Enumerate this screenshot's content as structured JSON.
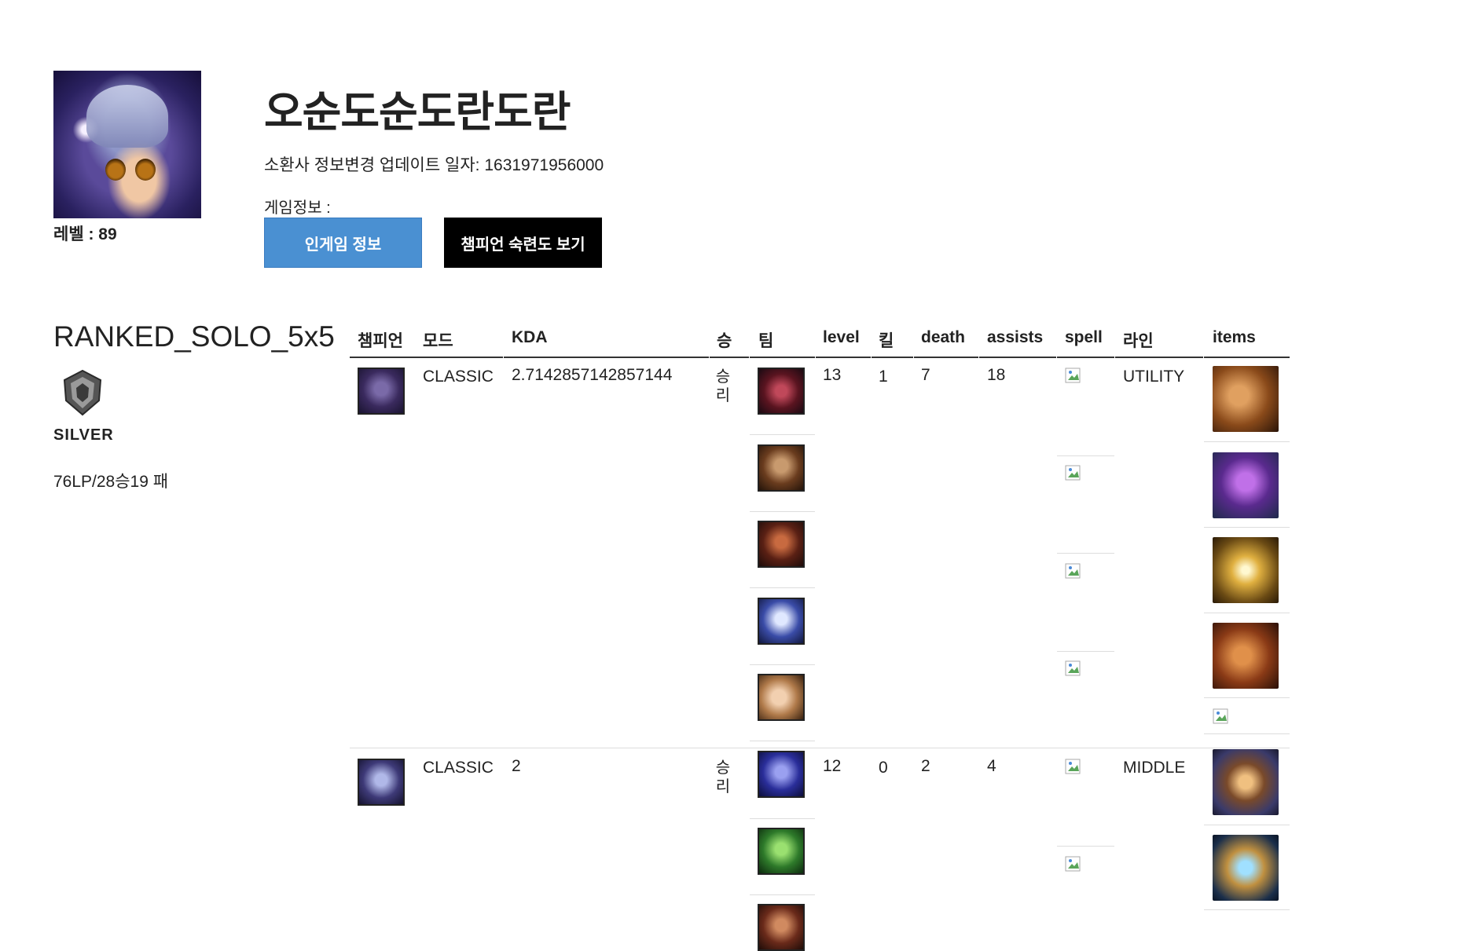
{
  "summoner": {
    "name": "오순도순도란도란",
    "level_text": "레벨 : 89",
    "update_text": "소환사 정보변경 업데이트 일자: 1631971956000",
    "game_info_label": "게임정보 :",
    "buttons": {
      "ingame": "인게임 정보",
      "mastery": "챔피언 숙련도 보기"
    }
  },
  "league": {
    "queue": "RANKED_SOLO_5x5",
    "tier": "SILVER",
    "record": "76LP/28승19 패"
  },
  "table": {
    "headers": [
      "챔피언",
      "모드",
      "KDA",
      "승",
      "팀",
      "level",
      "킬",
      "death",
      "assists",
      "spell",
      "라인",
      "items"
    ]
  },
  "matches": [
    {
      "mode": "CLASSIC",
      "kda": "2.7142857142857144",
      "win": "승리",
      "level": "13",
      "kills": "1",
      "deaths": "7",
      "assists": "18",
      "lane": "UTILITY"
    },
    {
      "mode": "CLASSIC",
      "kda": "2",
      "win": "승리",
      "level": "12",
      "kills": "0",
      "deaths": "2",
      "assists": "4",
      "lane": "MIDDLE"
    }
  ],
  "colors": {
    "primary_button": "#4a90d2",
    "dark_button": "#000000",
    "text": "#222222"
  }
}
